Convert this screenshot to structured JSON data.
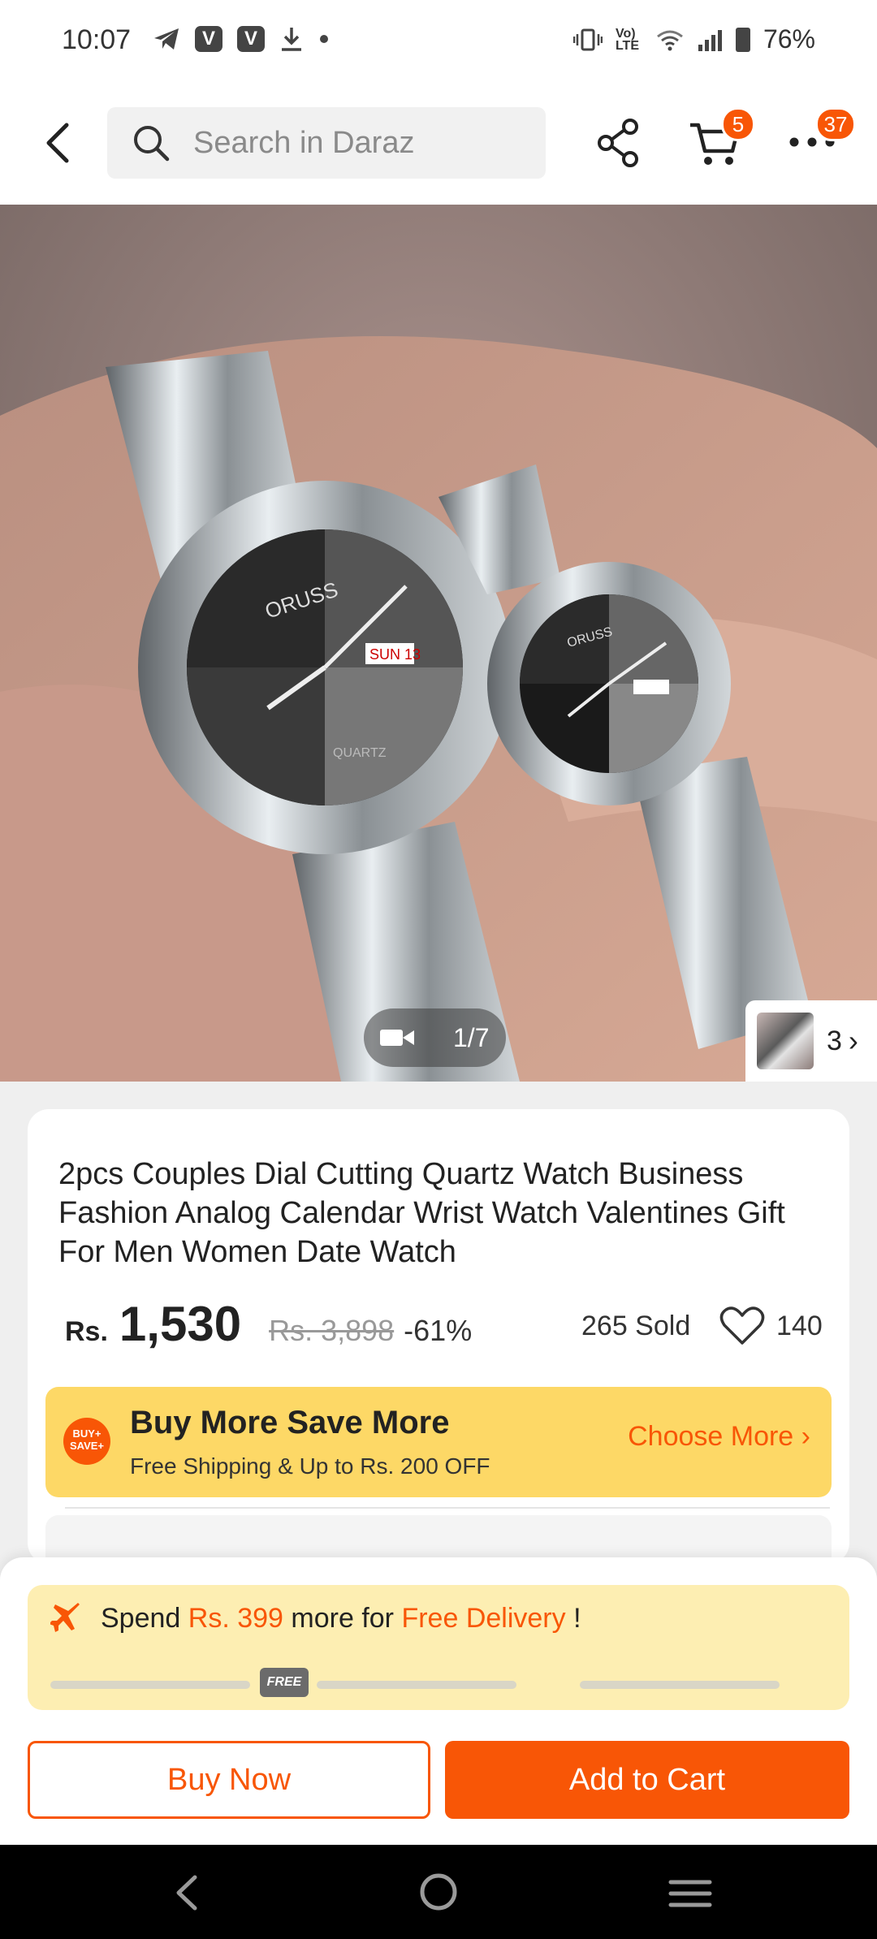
{
  "status_bar": {
    "time": "10:07",
    "app_icons": [
      "V",
      "V"
    ],
    "signal_label": "Vo) LTE",
    "battery": "76%"
  },
  "top_nav": {
    "search_placeholder": "Search in Daraz",
    "cart_badge": "5",
    "more_badge": "37"
  },
  "gallery": {
    "counter": "1/7",
    "variant_count": "3",
    "has_video": true
  },
  "product": {
    "title": "2pcs Couples Dial Cutting Quartz Watch Business Fashion Analog Calendar Wrist Watch Valentines Gift For Men Women Date Watch",
    "currency": "Rs.",
    "price": "1,530",
    "original_price": "Rs. 3,898",
    "discount": "-61%",
    "sold": "265 Sold",
    "wishlist_count": "140"
  },
  "promo": {
    "badge_text": "BUY+ SAVE+",
    "title": "Buy More Save More",
    "subtitle": "Free Shipping & Up to Rs. 200 OFF",
    "link": "Choose More"
  },
  "delivery": {
    "prefix": "Spend",
    "amount": "Rs. 399",
    "middle": "more for",
    "highlight": "Free Delivery",
    "suffix": "!",
    "tag": "FREE"
  },
  "actions": {
    "buy_now": "Buy Now",
    "add_to_cart": "Add to Cart"
  },
  "colors": {
    "accent": "#f85606",
    "promo_bg": "#fdd866",
    "delivery_bg": "#fdeeb2"
  }
}
